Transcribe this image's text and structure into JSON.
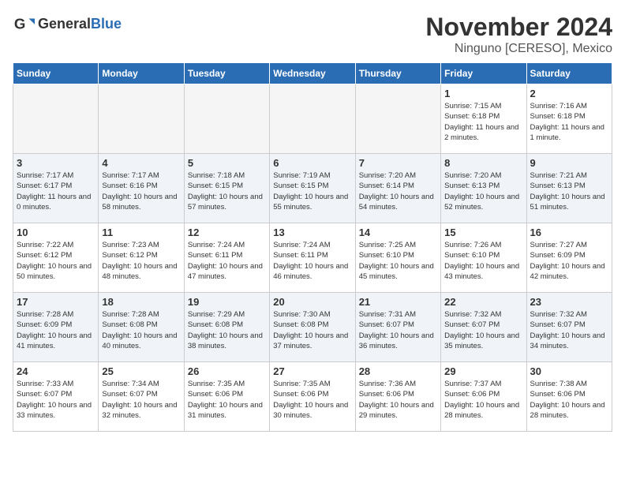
{
  "header": {
    "logo_general": "General",
    "logo_blue": "Blue",
    "month_title": "November 2024",
    "location": "Ninguno [CERESO], Mexico"
  },
  "days_of_week": [
    "Sunday",
    "Monday",
    "Tuesday",
    "Wednesday",
    "Thursday",
    "Friday",
    "Saturday"
  ],
  "weeks": [
    [
      {
        "day": "",
        "info": "",
        "empty": true
      },
      {
        "day": "",
        "info": "",
        "empty": true
      },
      {
        "day": "",
        "info": "",
        "empty": true
      },
      {
        "day": "",
        "info": "",
        "empty": true
      },
      {
        "day": "",
        "info": "",
        "empty": true
      },
      {
        "day": "1",
        "info": "Sunrise: 7:15 AM\nSunset: 6:18 PM\nDaylight: 11 hours and 2 minutes."
      },
      {
        "day": "2",
        "info": "Sunrise: 7:16 AM\nSunset: 6:18 PM\nDaylight: 11 hours and 1 minute."
      }
    ],
    [
      {
        "day": "3",
        "info": "Sunrise: 7:17 AM\nSunset: 6:17 PM\nDaylight: 11 hours and 0 minutes."
      },
      {
        "day": "4",
        "info": "Sunrise: 7:17 AM\nSunset: 6:16 PM\nDaylight: 10 hours and 58 minutes."
      },
      {
        "day": "5",
        "info": "Sunrise: 7:18 AM\nSunset: 6:15 PM\nDaylight: 10 hours and 57 minutes."
      },
      {
        "day": "6",
        "info": "Sunrise: 7:19 AM\nSunset: 6:15 PM\nDaylight: 10 hours and 55 minutes."
      },
      {
        "day": "7",
        "info": "Sunrise: 7:20 AM\nSunset: 6:14 PM\nDaylight: 10 hours and 54 minutes."
      },
      {
        "day": "8",
        "info": "Sunrise: 7:20 AM\nSunset: 6:13 PM\nDaylight: 10 hours and 52 minutes."
      },
      {
        "day": "9",
        "info": "Sunrise: 7:21 AM\nSunset: 6:13 PM\nDaylight: 10 hours and 51 minutes."
      }
    ],
    [
      {
        "day": "10",
        "info": "Sunrise: 7:22 AM\nSunset: 6:12 PM\nDaylight: 10 hours and 50 minutes."
      },
      {
        "day": "11",
        "info": "Sunrise: 7:23 AM\nSunset: 6:12 PM\nDaylight: 10 hours and 48 minutes."
      },
      {
        "day": "12",
        "info": "Sunrise: 7:24 AM\nSunset: 6:11 PM\nDaylight: 10 hours and 47 minutes."
      },
      {
        "day": "13",
        "info": "Sunrise: 7:24 AM\nSunset: 6:11 PM\nDaylight: 10 hours and 46 minutes."
      },
      {
        "day": "14",
        "info": "Sunrise: 7:25 AM\nSunset: 6:10 PM\nDaylight: 10 hours and 45 minutes."
      },
      {
        "day": "15",
        "info": "Sunrise: 7:26 AM\nSunset: 6:10 PM\nDaylight: 10 hours and 43 minutes."
      },
      {
        "day": "16",
        "info": "Sunrise: 7:27 AM\nSunset: 6:09 PM\nDaylight: 10 hours and 42 minutes."
      }
    ],
    [
      {
        "day": "17",
        "info": "Sunrise: 7:28 AM\nSunset: 6:09 PM\nDaylight: 10 hours and 41 minutes."
      },
      {
        "day": "18",
        "info": "Sunrise: 7:28 AM\nSunset: 6:08 PM\nDaylight: 10 hours and 40 minutes."
      },
      {
        "day": "19",
        "info": "Sunrise: 7:29 AM\nSunset: 6:08 PM\nDaylight: 10 hours and 38 minutes."
      },
      {
        "day": "20",
        "info": "Sunrise: 7:30 AM\nSunset: 6:08 PM\nDaylight: 10 hours and 37 minutes."
      },
      {
        "day": "21",
        "info": "Sunrise: 7:31 AM\nSunset: 6:07 PM\nDaylight: 10 hours and 36 minutes."
      },
      {
        "day": "22",
        "info": "Sunrise: 7:32 AM\nSunset: 6:07 PM\nDaylight: 10 hours and 35 minutes."
      },
      {
        "day": "23",
        "info": "Sunrise: 7:32 AM\nSunset: 6:07 PM\nDaylight: 10 hours and 34 minutes."
      }
    ],
    [
      {
        "day": "24",
        "info": "Sunrise: 7:33 AM\nSunset: 6:07 PM\nDaylight: 10 hours and 33 minutes."
      },
      {
        "day": "25",
        "info": "Sunrise: 7:34 AM\nSunset: 6:07 PM\nDaylight: 10 hours and 32 minutes."
      },
      {
        "day": "26",
        "info": "Sunrise: 7:35 AM\nSunset: 6:06 PM\nDaylight: 10 hours and 31 minutes."
      },
      {
        "day": "27",
        "info": "Sunrise: 7:35 AM\nSunset: 6:06 PM\nDaylight: 10 hours and 30 minutes."
      },
      {
        "day": "28",
        "info": "Sunrise: 7:36 AM\nSunset: 6:06 PM\nDaylight: 10 hours and 29 minutes."
      },
      {
        "day": "29",
        "info": "Sunrise: 7:37 AM\nSunset: 6:06 PM\nDaylight: 10 hours and 28 minutes."
      },
      {
        "day": "30",
        "info": "Sunrise: 7:38 AM\nSunset: 6:06 PM\nDaylight: 10 hours and 28 minutes."
      }
    ]
  ]
}
